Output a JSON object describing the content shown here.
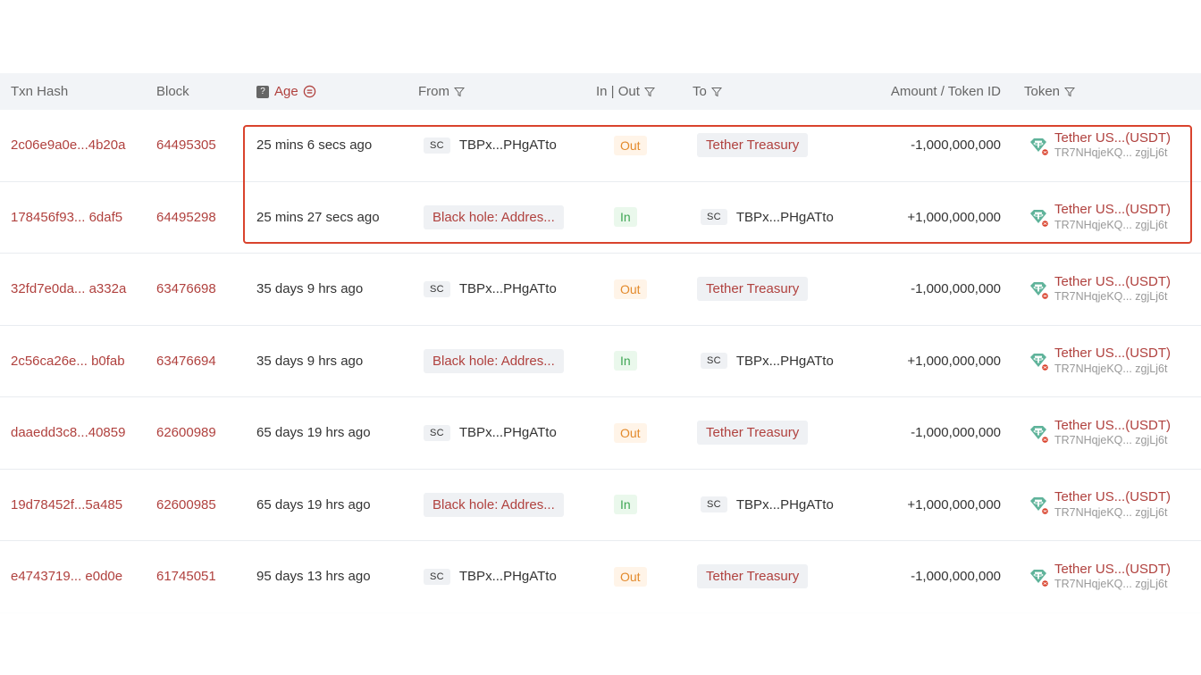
{
  "headers": {
    "txn_hash": "Txn Hash",
    "block": "Block",
    "age": "Age",
    "from": "From",
    "in_out": "In | Out",
    "to": "To",
    "amount": "Amount / Token ID",
    "token": "Token"
  },
  "sc_label": "SC",
  "colors": {
    "link": "#b0413e",
    "out": "#e38a2c",
    "in": "#3fa654",
    "highlight": "#d9432d",
    "tether_green": "#5fb39a"
  },
  "rows": [
    {
      "hash": "2c06e9a0e...4b20a",
      "block": "64495305",
      "age": "25 mins 6 secs ago",
      "from": "TBPx...PHgATto",
      "from_sc": true,
      "dir": "Out",
      "to": "Tether Treasury",
      "to_sc": false,
      "amount": "-1,000,000,000",
      "token_name": "Tether US...(USDT)",
      "token_addr": "TR7NHqjeKQ... zgjLj6t"
    },
    {
      "hash": "178456f93... 6daf5",
      "block": "64495298",
      "age": "25 mins 27 secs ago",
      "from": "Black hole: Addres...",
      "from_sc": false,
      "dir": "In",
      "to": "TBPx...PHgATto",
      "to_sc": true,
      "amount": "+1,000,000,000",
      "token_name": "Tether US...(USDT)",
      "token_addr": "TR7NHqjeKQ... zgjLj6t"
    },
    {
      "hash": "32fd7e0da... a332a",
      "block": "63476698",
      "age": "35 days 9 hrs ago",
      "from": "TBPx...PHgATto",
      "from_sc": true,
      "dir": "Out",
      "to": "Tether Treasury",
      "to_sc": false,
      "amount": "-1,000,000,000",
      "token_name": "Tether US...(USDT)",
      "token_addr": "TR7NHqjeKQ... zgjLj6t"
    },
    {
      "hash": "2c56ca26e... b0fab",
      "block": "63476694",
      "age": "35 days 9 hrs ago",
      "from": "Black hole: Addres...",
      "from_sc": false,
      "dir": "In",
      "to": "TBPx...PHgATto",
      "to_sc": true,
      "amount": "+1,000,000,000",
      "token_name": "Tether US...(USDT)",
      "token_addr": "TR7NHqjeKQ... zgjLj6t"
    },
    {
      "hash": "daaedd3c8...40859",
      "block": "62600989",
      "age": "65 days 19 hrs ago",
      "from": "TBPx...PHgATto",
      "from_sc": true,
      "dir": "Out",
      "to": "Tether Treasury",
      "to_sc": false,
      "amount": "-1,000,000,000",
      "token_name": "Tether US...(USDT)",
      "token_addr": "TR7NHqjeKQ... zgjLj6t"
    },
    {
      "hash": "19d78452f...5a485",
      "block": "62600985",
      "age": "65 days 19 hrs ago",
      "from": "Black hole: Addres...",
      "from_sc": false,
      "dir": "In",
      "to": "TBPx...PHgATto",
      "to_sc": true,
      "amount": "+1,000,000,000",
      "token_name": "Tether US...(USDT)",
      "token_addr": "TR7NHqjeKQ... zgjLj6t"
    },
    {
      "hash": "e4743719... e0d0e",
      "block": "61745051",
      "age": "95 days 13 hrs ago",
      "from": "TBPx...PHgATto",
      "from_sc": true,
      "dir": "Out",
      "to": "Tether Treasury",
      "to_sc": false,
      "amount": "-1,000,000,000",
      "token_name": "Tether US...(USDT)",
      "token_addr": "TR7NHqjeKQ... zgjLj6t"
    }
  ]
}
